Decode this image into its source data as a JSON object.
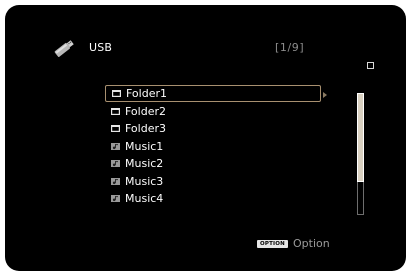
{
  "header": {
    "source_icon": "usb-stick-icon",
    "source_label": "USB",
    "page_counter": "[1/9]"
  },
  "list": {
    "items": [
      {
        "label": "Folder1",
        "icon": "folder-icon",
        "selected": true
      },
      {
        "label": "Folder2",
        "icon": "folder-icon",
        "selected": false
      },
      {
        "label": "Folder3",
        "icon": "folder-icon",
        "selected": false
      },
      {
        "label": "Music1",
        "icon": "music-file-icon",
        "selected": false
      },
      {
        "label": "Music2",
        "icon": "music-file-icon",
        "selected": false
      },
      {
        "label": "Music3",
        "icon": "music-file-icon",
        "selected": false
      },
      {
        "label": "Music4",
        "icon": "music-file-icon",
        "selected": false
      }
    ]
  },
  "scrollbar": {
    "position_fraction": 0.0,
    "visible_fraction": 0.73
  },
  "footer": {
    "option_badge": "OPTION",
    "option_label": "Option"
  },
  "colors": {
    "background": "#000000",
    "selection_border": "#a89070",
    "text": "#ffffff",
    "muted_text": "#9a9a9a"
  }
}
